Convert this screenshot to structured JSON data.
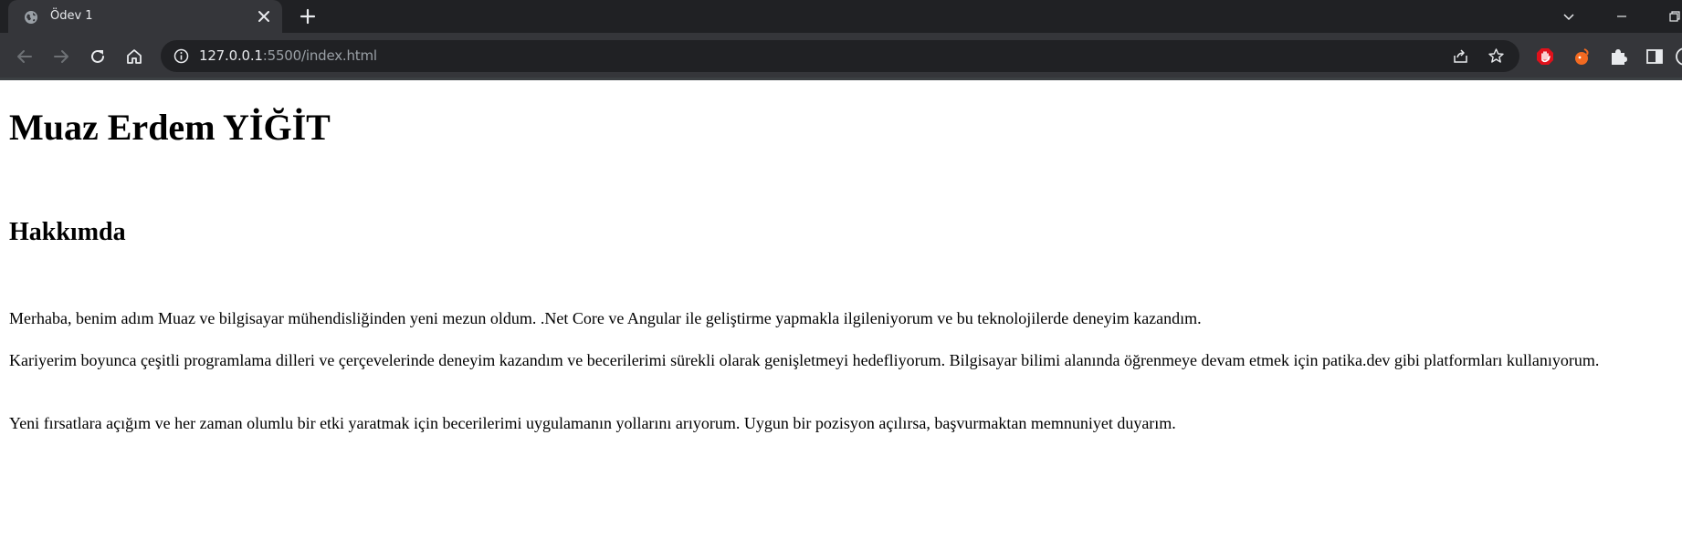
{
  "browser": {
    "tab": {
      "title": "Ödev 1"
    },
    "address_bar": {
      "host": "127.0.0.1",
      "rest": ":5500/index.html"
    },
    "colors": {
      "tabstrip": "#202124",
      "toolbar": "#35363a",
      "omnibox": "#202124",
      "text": "#e8eaed",
      "muted": "#9aa0a6"
    },
    "icons": {
      "tab_favicon": "globe-icon",
      "tab_close": "close-icon",
      "new_tab": "plus-icon",
      "back": "arrow-left-icon",
      "forward": "arrow-right-icon",
      "reload": "reload-icon",
      "home": "home-icon",
      "site_info": "info-icon",
      "share": "share-icon",
      "bookmark": "star-icon",
      "ext_block": "hand-stop-icon",
      "ext_orange": "bird-icon",
      "extensions": "puzzle-icon",
      "side_panel": "side-panel-icon"
    }
  },
  "page": {
    "heading": "Muaz Erdem YİĞİT",
    "section_title": "Hakkımda",
    "paragraphs": [
      "Merhaba, benim adım Muaz ve bilgisayar mühendisliğinden yeni mezun oldum. .Net Core ve Angular ile geliştirme yapmakla ilgileniyorum ve bu teknolojilerde deneyim kazandım.",
      "Kariyerim boyunca çeşitli programlama dilleri ve çerçevelerinde deneyim kazandım ve becerilerimi sürekli olarak genişletmeyi hedefliyorum. Bilgisayar bilimi alanında öğrenmeye devam etmek için patika.dev gibi platformları kullanıyorum.",
      "Yeni fırsatlara açığım ve her zaman olumlu bir etki yaratmak için becerilerimi uygulamanın yollarını arıyorum. Uygun bir pozisyon açılırsa, başvurmaktan memnuniyet duyarım."
    ]
  }
}
